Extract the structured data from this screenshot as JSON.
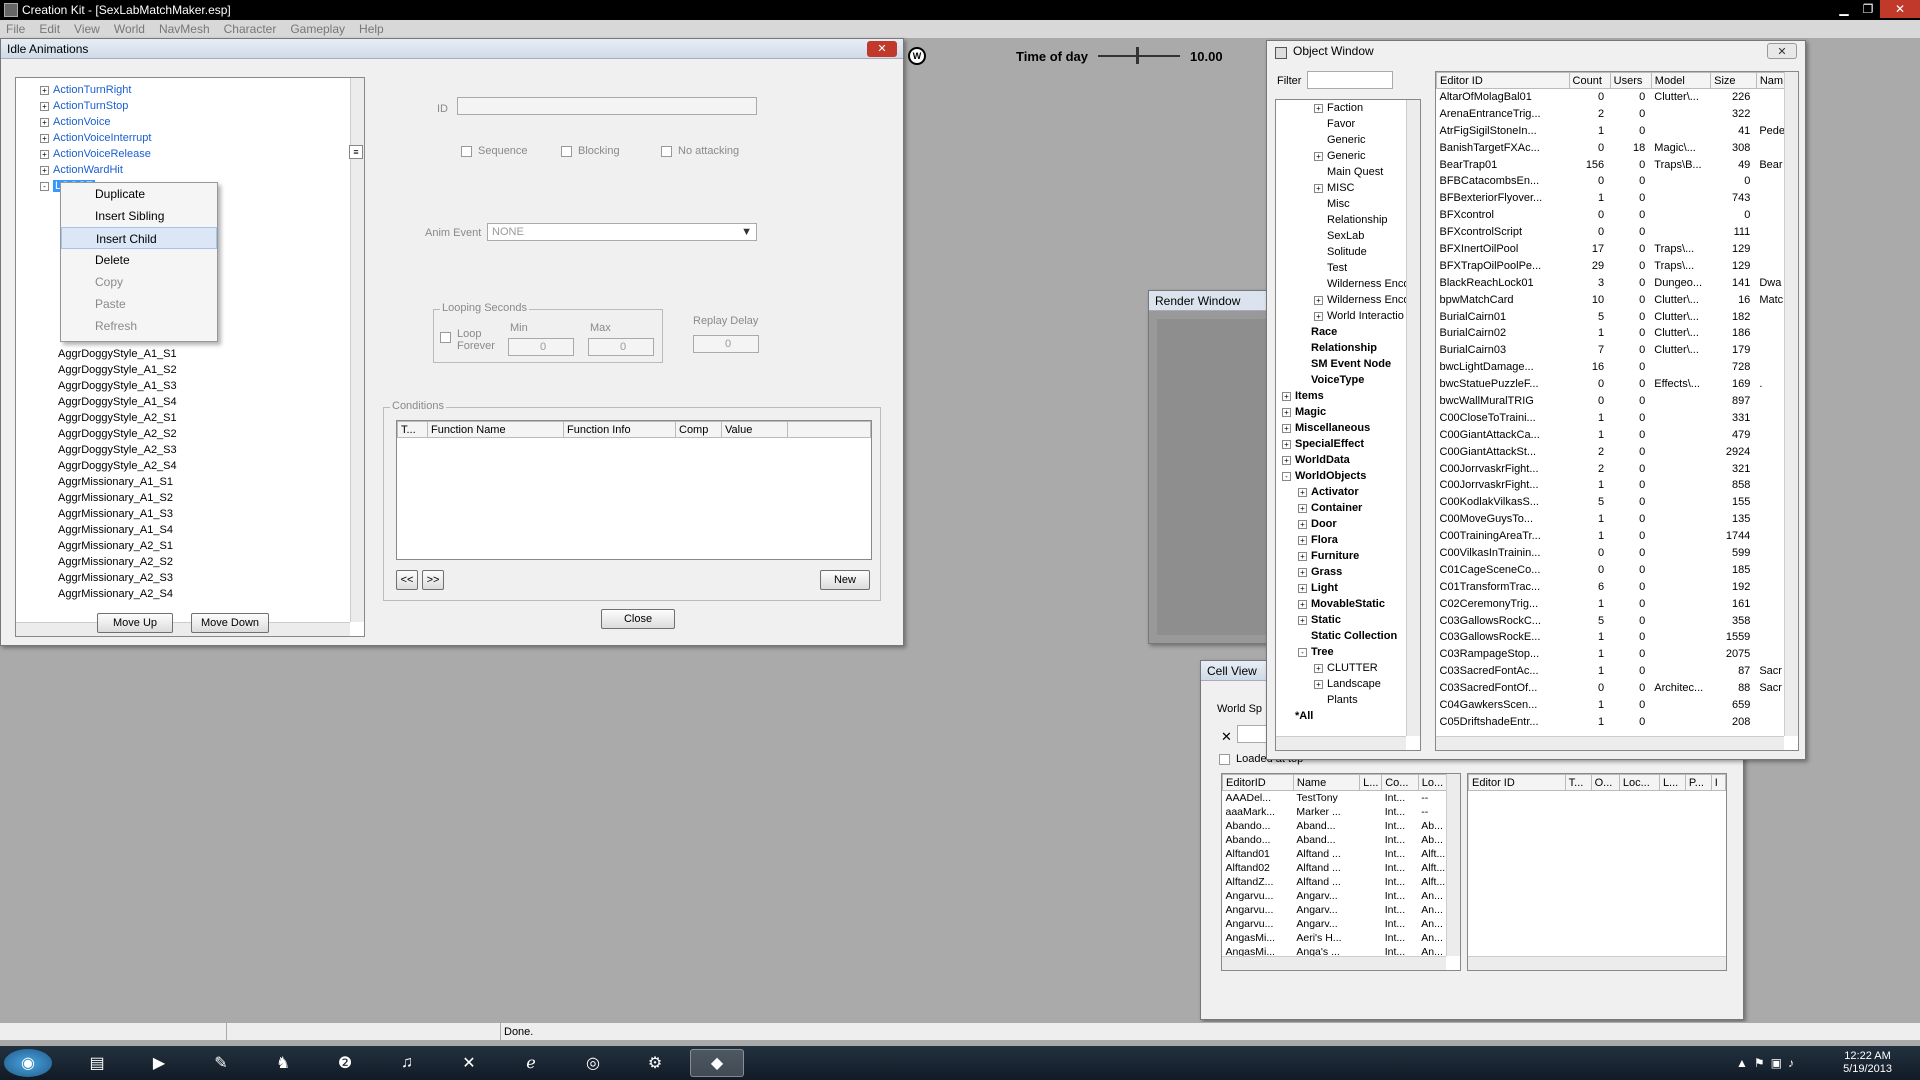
{
  "app": {
    "title": "Creation Kit - [SexLabMatchMaker.esp]"
  },
  "menu": [
    "File",
    "Edit",
    "View",
    "World",
    "NavMesh",
    "Character",
    "Gameplay",
    "Help"
  ],
  "toolbar": {
    "time_label": "Time of day",
    "time_value": "10.00"
  },
  "idle": {
    "title": "Idle Animations",
    "tree_items": [
      "ActionTurnRight",
      "ActionTurnStop",
      "ActionVoice",
      "ActionVoiceInterrupt",
      "ActionVoiceRelease",
      "ActionWardHit",
      "LOOSE"
    ],
    "tree_children": [
      "AggrDoggyStyle_A1_S1",
      "AggrDoggyStyle_A1_S2",
      "AggrDoggyStyle_A1_S3",
      "AggrDoggyStyle_A1_S4",
      "AggrDoggyStyle_A2_S1",
      "AggrDoggyStyle_A2_S2",
      "AggrDoggyStyle_A2_S3",
      "AggrDoggyStyle_A2_S4",
      "AggrMissionary_A1_S1",
      "AggrMissionary_A1_S2",
      "AggrMissionary_A1_S3",
      "AggrMissionary_A1_S4",
      "AggrMissionary_A2_S1",
      "AggrMissionary_A2_S2",
      "AggrMissionary_A2_S3",
      "AggrMissionary_A2_S4"
    ],
    "context_menu": [
      {
        "label": "Duplicate",
        "enabled": true
      },
      {
        "label": "Insert Sibling",
        "enabled": true
      },
      {
        "label": "Insert Child",
        "enabled": true
      },
      {
        "label": "Delete",
        "enabled": true
      },
      {
        "label": "Copy",
        "enabled": false
      },
      {
        "label": "Paste",
        "enabled": false
      },
      {
        "label": "Refresh",
        "enabled": false
      }
    ],
    "id_label": "ID",
    "sequence": "Sequence",
    "blocking": "Blocking",
    "no_attacking": "No attacking",
    "anim_event_label": "Anim Event",
    "anim_event_value": "NONE",
    "looping_label": "Looping Seconds",
    "loop_forever": "Loop Forever",
    "min_label": "Min",
    "max_label": "Max",
    "min_value": "0",
    "max_value": "0",
    "replay_label": "Replay Delay",
    "replay_value": "0",
    "conditions_label": "Conditions",
    "cond_cols": [
      "T...",
      "Function Name",
      "Function Info",
      "Comp",
      "Value"
    ],
    "prev": "<<",
    "next": ">>",
    "new": "New",
    "move_up": "Move Up",
    "move_down": "Move Down",
    "close": "Close"
  },
  "render": {
    "title": "Render Window"
  },
  "object": {
    "title": "Object Window",
    "filter_label": "Filter",
    "tree": [
      {
        "label": "Faction",
        "depth": 2,
        "exp": "+",
        "bold": false
      },
      {
        "label": "Favor",
        "depth": 2,
        "exp": "",
        "bold": false
      },
      {
        "label": "Generic",
        "depth": 2,
        "exp": "",
        "bold": false
      },
      {
        "label": "Generic",
        "depth": 2,
        "exp": "+",
        "bold": false
      },
      {
        "label": "Main Quest",
        "depth": 2,
        "exp": "",
        "bold": false
      },
      {
        "label": "MISC",
        "depth": 2,
        "exp": "+",
        "bold": false
      },
      {
        "label": "Misc",
        "depth": 2,
        "exp": "",
        "bold": false
      },
      {
        "label": "Relationship",
        "depth": 2,
        "exp": "",
        "bold": false
      },
      {
        "label": "SexLab",
        "depth": 2,
        "exp": "",
        "bold": false
      },
      {
        "label": "Solitude",
        "depth": 2,
        "exp": "",
        "bold": false
      },
      {
        "label": "Test",
        "depth": 2,
        "exp": "",
        "bold": false
      },
      {
        "label": "Wilderness Enco",
        "depth": 2,
        "exp": "",
        "bold": false
      },
      {
        "label": "Wilderness Enco",
        "depth": 2,
        "exp": "+",
        "bold": false
      },
      {
        "label": "World Interactio",
        "depth": 2,
        "exp": "+",
        "bold": false
      },
      {
        "label": "Race",
        "depth": 1,
        "exp": "",
        "bold": true
      },
      {
        "label": "Relationship",
        "depth": 1,
        "exp": "",
        "bold": true
      },
      {
        "label": "SM Event Node",
        "depth": 1,
        "exp": "",
        "bold": true
      },
      {
        "label": "VoiceType",
        "depth": 1,
        "exp": "",
        "bold": true
      },
      {
        "label": "Items",
        "depth": 0,
        "exp": "+",
        "bold": true
      },
      {
        "label": "Magic",
        "depth": 0,
        "exp": "+",
        "bold": true
      },
      {
        "label": "Miscellaneous",
        "depth": 0,
        "exp": "+",
        "bold": true
      },
      {
        "label": "SpecialEffect",
        "depth": 0,
        "exp": "+",
        "bold": true
      },
      {
        "label": "WorldData",
        "depth": 0,
        "exp": "+",
        "bold": true
      },
      {
        "label": "WorldObjects",
        "depth": 0,
        "exp": "-",
        "bold": true
      },
      {
        "label": "Activator",
        "depth": 1,
        "exp": "+",
        "bold": true
      },
      {
        "label": "Container",
        "depth": 1,
        "exp": "+",
        "bold": true
      },
      {
        "label": "Door",
        "depth": 1,
        "exp": "+",
        "bold": true
      },
      {
        "label": "Flora",
        "depth": 1,
        "exp": "+",
        "bold": true
      },
      {
        "label": "Furniture",
        "depth": 1,
        "exp": "+",
        "bold": true
      },
      {
        "label": "Grass",
        "depth": 1,
        "exp": "+",
        "bold": true
      },
      {
        "label": "Light",
        "depth": 1,
        "exp": "+",
        "bold": true
      },
      {
        "label": "MovableStatic",
        "depth": 1,
        "exp": "+",
        "bold": true
      },
      {
        "label": "Static",
        "depth": 1,
        "exp": "+",
        "bold": true
      },
      {
        "label": "Static Collection",
        "depth": 1,
        "exp": "",
        "bold": true
      },
      {
        "label": "Tree",
        "depth": 1,
        "exp": "-",
        "bold": true
      },
      {
        "label": "CLUTTER",
        "depth": 2,
        "exp": "+",
        "bold": false
      },
      {
        "label": "Landscape",
        "depth": 2,
        "exp": "+",
        "bold": false
      },
      {
        "label": "Plants",
        "depth": 2,
        "exp": "",
        "bold": false
      },
      {
        "label": "*All",
        "depth": 0,
        "exp": "",
        "bold": true
      }
    ],
    "columns": [
      "Editor ID",
      "Count",
      "Users",
      "Model",
      "Size",
      "Nam"
    ],
    "rows": [
      [
        "AltarOfMolagBal01",
        "0",
        "0",
        "Clutter\\...",
        "226",
        ""
      ],
      [
        "ArenaEntranceTrig...",
        "2",
        "0",
        "",
        "322",
        ""
      ],
      [
        "AtrFigSigilStoneIn...",
        "1",
        "0",
        "",
        "41",
        "Pede"
      ],
      [
        "BanishTargetFXAc...",
        "0",
        "18",
        "Magic\\...",
        "308",
        ""
      ],
      [
        "BearTrap01",
        "156",
        "0",
        "Traps\\B...",
        "49",
        "Bear"
      ],
      [
        "BFBCatacombsEn...",
        "0",
        "0",
        "",
        "0",
        ""
      ],
      [
        "BFBexteriorFlyover...",
        "1",
        "0",
        "",
        "743",
        ""
      ],
      [
        "BFXcontrol",
        "0",
        "0",
        "",
        "0",
        ""
      ],
      [
        "BFXcontrolScript",
        "0",
        "0",
        "",
        "111",
        ""
      ],
      [
        "BFXInertOilPool",
        "17",
        "0",
        "Traps\\...",
        "129",
        ""
      ],
      [
        "BFXTrapOilPoolPe...",
        "29",
        "0",
        "Traps\\...",
        "129",
        ""
      ],
      [
        "BlackReachLock01",
        "3",
        "0",
        "Dungeo...",
        "141",
        "Dwa"
      ],
      [
        "bpwMatchCard",
        "10",
        "0",
        "Clutter\\...",
        "16",
        "Matc"
      ],
      [
        "BurialCairn01",
        "5",
        "0",
        "Clutter\\...",
        "182",
        ""
      ],
      [
        "BurialCairn02",
        "1",
        "0",
        "Clutter\\...",
        "186",
        ""
      ],
      [
        "BurialCairn03",
        "7",
        "0",
        "Clutter\\...",
        "179",
        ""
      ],
      [
        "bwcLightDamage...",
        "16",
        "0",
        "",
        "728",
        ""
      ],
      [
        "bwcStatuePuzzleF...",
        "0",
        "0",
        "Effects\\...",
        "169",
        "."
      ],
      [
        "bwcWallMuralTRIG",
        "0",
        "0",
        "",
        "897",
        ""
      ],
      [
        "C00CloseToTraini...",
        "1",
        "0",
        "",
        "331",
        ""
      ],
      [
        "C00GiantAttackCa...",
        "1",
        "0",
        "",
        "479",
        ""
      ],
      [
        "C00GiantAttackSt...",
        "2",
        "0",
        "",
        "2924",
        ""
      ],
      [
        "C00JorrvaskrFight...",
        "2",
        "0",
        "",
        "321",
        ""
      ],
      [
        "C00JorrvaskrFight...",
        "1",
        "0",
        "",
        "858",
        ""
      ],
      [
        "C00KodlakVilkasS...",
        "5",
        "0",
        "",
        "155",
        ""
      ],
      [
        "C00MoveGuysTo...",
        "1",
        "0",
        "",
        "135",
        ""
      ],
      [
        "C00TrainingAreaTr...",
        "1",
        "0",
        "",
        "1744",
        ""
      ],
      [
        "C00VilkasInTrainin...",
        "0",
        "0",
        "",
        "599",
        ""
      ],
      [
        "C01CageSceneCo...",
        "0",
        "0",
        "",
        "185",
        ""
      ],
      [
        "C01TransformTrac...",
        "6",
        "0",
        "",
        "192",
        ""
      ],
      [
        "C02CeremonyTrig...",
        "1",
        "0",
        "",
        "161",
        ""
      ],
      [
        "C03GallowsRockC...",
        "5",
        "0",
        "",
        "358",
        ""
      ],
      [
        "C03GallowsRockE...",
        "1",
        "0",
        "",
        "1559",
        ""
      ],
      [
        "C03RampageStop...",
        "1",
        "0",
        "",
        "2075",
        ""
      ],
      [
        "C03SacredFontAc...",
        "1",
        "0",
        "",
        "87",
        "Sacr"
      ],
      [
        "C03SacredFontOf...",
        "0",
        "0",
        "Architec...",
        "88",
        "Sacr"
      ],
      [
        "C04GawkersScen...",
        "1",
        "0",
        "",
        "659",
        ""
      ],
      [
        "C05DriftshadeEntr...",
        "1",
        "0",
        "",
        "208",
        ""
      ]
    ]
  },
  "cell": {
    "title": "Cell View",
    "world_label": "World Sp",
    "loaded_label": "Loaded at top",
    "left_cols": [
      "EditorID",
      "Name",
      "L...",
      "Co...",
      "Lo..."
    ],
    "left_rows": [
      [
        "AAADel...",
        "TestTony",
        "",
        "Int...",
        "--"
      ],
      [
        "aaaMark...",
        "Marker ...",
        "",
        "Int...",
        "--"
      ],
      [
        "Abando...",
        "Aband...",
        "",
        "Int...",
        "Ab..."
      ],
      [
        "Abando...",
        "Aband...",
        "",
        "Int...",
        "Ab..."
      ],
      [
        "Alftand01",
        "Alftand ...",
        "",
        "Int...",
        "Alft..."
      ],
      [
        "Alftand02",
        "Alftand ...",
        "",
        "Int...",
        "Alft..."
      ],
      [
        "AlftandZ...",
        "Alftand ...",
        "",
        "Int...",
        "Alft..."
      ],
      [
        "Angarvu...",
        "Angarv...",
        "",
        "Int...",
        "An..."
      ],
      [
        "Angarvu...",
        "Angarv...",
        "",
        "Int...",
        "An..."
      ],
      [
        "Angarvu...",
        "Angarv...",
        "",
        "Int...",
        "An..."
      ],
      [
        "AngasMi...",
        "Aeri's H...",
        "",
        "Int...",
        "An..."
      ],
      [
        "AngasMi...",
        "Anga's ...",
        "",
        "Int...",
        "An..."
      ]
    ],
    "right_cols": [
      "Editor ID",
      "T...",
      "O...",
      "Loc...",
      "L...",
      "P...",
      "I"
    ]
  },
  "status": {
    "text": "Done."
  },
  "taskbar": {
    "time": "12:22 AM",
    "date": "5/19/2013",
    "items": [
      {
        "name": "start-orb-icon",
        "glyph": "◉",
        "active": false
      },
      {
        "name": "explorer-icon",
        "glyph": "▤",
        "active": false
      },
      {
        "name": "media-player-icon",
        "glyph": "▶",
        "active": false
      },
      {
        "name": "notepad-icon",
        "glyph": "✎",
        "active": false
      },
      {
        "name": "character-app-icon",
        "glyph": "♞",
        "active": false
      },
      {
        "name": "game-2-icon",
        "glyph": "❷",
        "active": false
      },
      {
        "name": "itunes-icon",
        "glyph": "♫",
        "active": false
      },
      {
        "name": "excel-icon",
        "glyph": "✕",
        "active": false
      },
      {
        "name": "internet-explorer-icon",
        "glyph": "ℯ",
        "active": false
      },
      {
        "name": "chrome-icon",
        "glyph": "◎",
        "active": false
      },
      {
        "name": "steam-icon",
        "glyph": "⚙",
        "active": false
      },
      {
        "name": "creation-kit-icon",
        "glyph": "◆",
        "active": true
      }
    ]
  }
}
